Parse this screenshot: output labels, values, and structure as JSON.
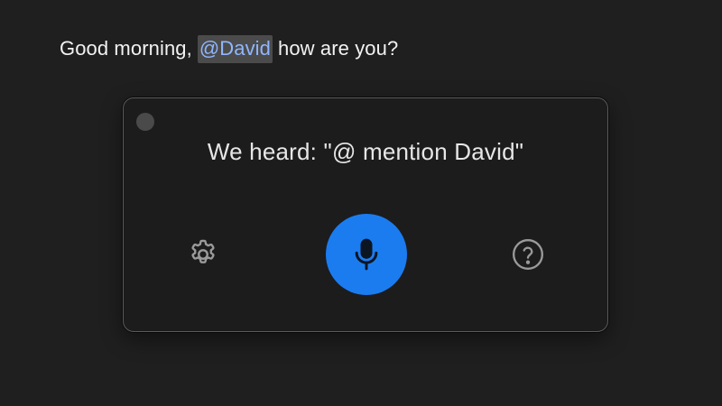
{
  "document": {
    "text_before": "Good morning,",
    "mention": "@David",
    "text_after": "how are you?"
  },
  "dictation_panel": {
    "heard_text": "We heard: \"@ mention David\"",
    "icons": {
      "close": "close-dot-icon",
      "settings": "gear-icon",
      "microphone": "microphone-icon",
      "help": "question-mark-icon"
    },
    "colors": {
      "mic_button": "#1b7cf0",
      "mention_text": "#8fb7ff",
      "mention_highlight": "#4b4b4b"
    }
  }
}
